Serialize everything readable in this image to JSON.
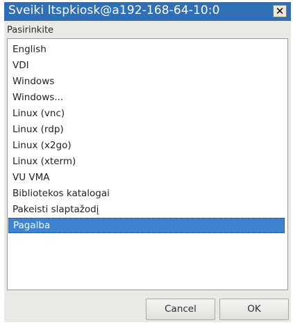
{
  "window": {
    "title": "Sveiki ltspkiosk@a192-168-64-10:0",
    "close_glyph": "✕",
    "colors": {
      "titlebar": "#2f6fb6",
      "selection": "#3d83cf",
      "window_bg": "#eae9e5"
    }
  },
  "prompt": {
    "label": "Pasirinkite"
  },
  "list": {
    "items": [
      {
        "label": "English"
      },
      {
        "label": "VDI"
      },
      {
        "label": "Windows"
      },
      {
        "label": "Windows..."
      },
      {
        "label": "Linux (vnc)"
      },
      {
        "label": "Linux (rdp)"
      },
      {
        "label": "Linux (x2go)"
      },
      {
        "label": "Linux (xterm)"
      },
      {
        "label": "VU VMA"
      },
      {
        "label": "Bibliotekos katalogai"
      },
      {
        "label": "Pakeisti slaptažodį"
      },
      {
        "label": "Pagalba"
      }
    ],
    "selected_label": "Pagalba"
  },
  "buttons": {
    "cancel_label": "Cancel",
    "ok_label": "OK"
  }
}
